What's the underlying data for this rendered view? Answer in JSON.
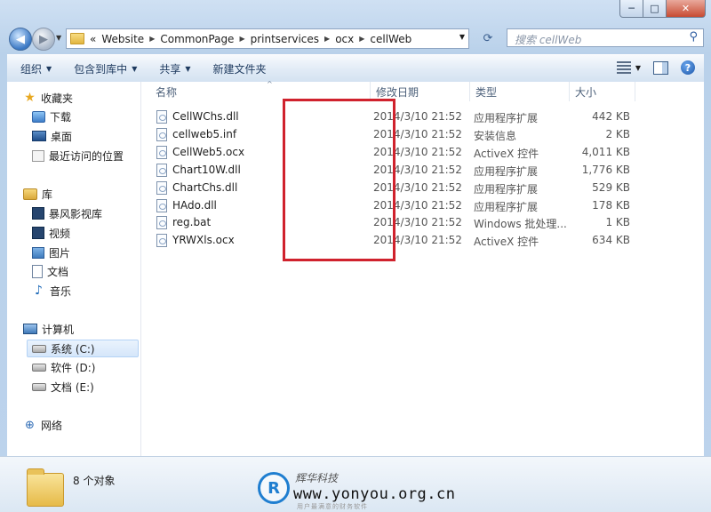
{
  "window": {
    "caption_buttons": {
      "minimize": "─",
      "maximize": "□",
      "close": "✕"
    }
  },
  "nav": {
    "back_icon": "back-arrow",
    "forward_icon": "forward-arrow",
    "address": {
      "prefix": "«",
      "crumbs": [
        "Website",
        "CommonPage",
        "printservices",
        "ocx",
        "cellWeb"
      ]
    },
    "search_placeholder": "搜索 cellWeb"
  },
  "toolbar": {
    "organize": "组织",
    "include_in_library": "包含到库中",
    "share": "共享",
    "new_folder": "新建文件夹"
  },
  "sidebar": {
    "favorites": {
      "title": "收藏夹",
      "items": [
        "下载",
        "桌面",
        "最近访问的位置"
      ]
    },
    "libraries": {
      "title": "库",
      "items": [
        "暴风影视库",
        "视频",
        "图片",
        "文档",
        "音乐"
      ]
    },
    "computer": {
      "title": "计算机",
      "items": [
        "系统 (C:)",
        "软件 (D:)",
        "文档 (E:)"
      ],
      "selected": "系统 (C:)"
    },
    "network": {
      "title": "网络"
    }
  },
  "columns": {
    "name": "名称",
    "date": "修改日期",
    "type": "类型",
    "size": "大小"
  },
  "files": [
    {
      "name": "CellWChs.dll",
      "date": "2014/3/10 21:52",
      "type": "应用程序扩展",
      "size": "442 KB"
    },
    {
      "name": "cellweb5.inf",
      "date": "2014/3/10 21:52",
      "type": "安装信息",
      "size": "2 KB"
    },
    {
      "name": "CellWeb5.ocx",
      "date": "2014/3/10 21:52",
      "type": "ActiveX 控件",
      "size": "4,011 KB"
    },
    {
      "name": "Chart10W.dll",
      "date": "2014/3/10 21:52",
      "type": "应用程序扩展",
      "size": "1,776 KB"
    },
    {
      "name": "ChartChs.dll",
      "date": "2014/3/10 21:52",
      "type": "应用程序扩展",
      "size": "529 KB"
    },
    {
      "name": "HAdo.dll",
      "date": "2014/3/10 21:52",
      "type": "应用程序扩展",
      "size": "178 KB"
    },
    {
      "name": "reg.bat",
      "date": "2014/3/10 21:52",
      "type": "Windows 批处理...",
      "size": "1 KB"
    },
    {
      "name": "YRWXls.ocx",
      "date": "2014/3/10 21:52",
      "type": "ActiveX 控件",
      "size": "634 KB"
    }
  ],
  "details": {
    "count": "8 个对象"
  },
  "watermark": {
    "logo": "R",
    "cn_name": "辉华科技",
    "url": "www.yonyou.org.cn",
    "slogan": "用户最满意的财务软件"
  },
  "colors": {
    "highlight_box": "#d0222d",
    "window_frame": "#bcd3ec"
  }
}
